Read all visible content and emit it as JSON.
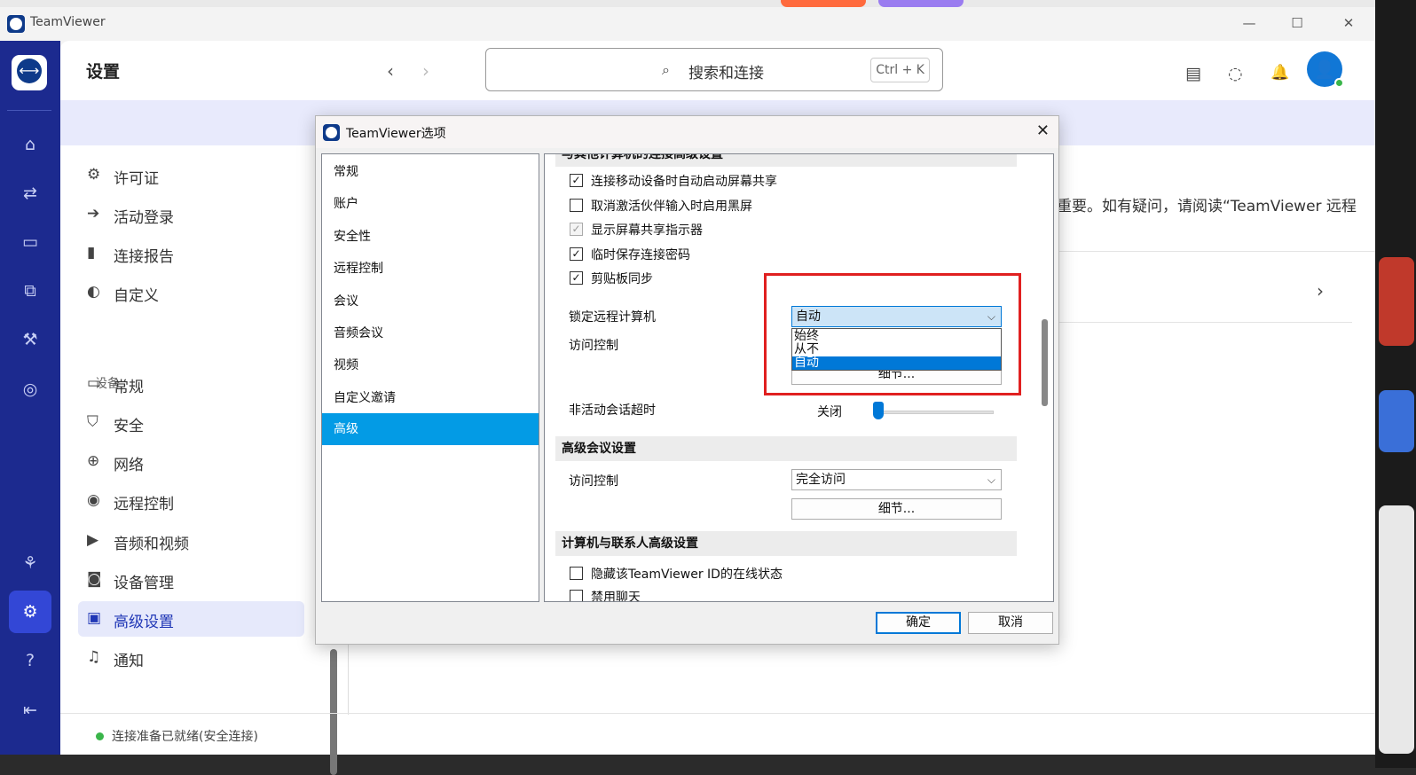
{
  "app": {
    "title": "TeamViewer",
    "window_controls": [
      "—",
      "☐",
      "✕"
    ]
  },
  "header": {
    "title": "设置",
    "back_icon": "‹",
    "forward_icon": "›",
    "search_icon": "⌕",
    "search_text": "搜索和连接",
    "search_shortcut": "Ctrl + K",
    "contact_icon": "▤",
    "chat_icon": "◌",
    "bell_icon": "🔔",
    "avatar_icon": "👤"
  },
  "nav_icons": [
    "⌂",
    "⇄",
    "▭",
    "⧉",
    "⚒",
    "◎",
    "⚘",
    "⚙",
    "?",
    "⇤"
  ],
  "settings_list": {
    "items_top": [
      {
        "icon": "⚙",
        "label": "许可证"
      },
      {
        "icon": "➔",
        "label": "活动登录"
      },
      {
        "icon": "▮",
        "label": "连接报告"
      },
      {
        "icon": "◐",
        "label": "自定义"
      }
    ],
    "group_label": "设备",
    "items_device": [
      {
        "icon": "▭",
        "label": "常规"
      },
      {
        "icon": "⛉",
        "label": "安全"
      },
      {
        "icon": "⊕",
        "label": "网络"
      },
      {
        "icon": "◉",
        "label": "远程控制"
      },
      {
        "icon": "▶",
        "label": "音频和视频"
      },
      {
        "icon": "◙",
        "label": "设备管理"
      },
      {
        "icon": "▣",
        "label": "高级设置"
      },
      {
        "icon": "♫",
        "label": "通知"
      }
    ]
  },
  "content": {
    "partial_text": "重要。如有疑问，请阅读“TeamViewer 远程",
    "chevron": "›"
  },
  "footer": {
    "status": "连接准备已就绪(安全连接)"
  },
  "dialog": {
    "title": "TeamViewer选项",
    "close": "✕",
    "categories": [
      "常规",
      "账户",
      "安全性",
      "远程控制",
      "会议",
      "音频会议",
      "视频",
      "自定义邀请",
      "高级"
    ],
    "selected_category": "高级",
    "section1_title": "与其他计算机的连接高级设置",
    "checkboxes1": [
      {
        "label": "连接移动设备时自动启动屏幕共享",
        "checked": "✓",
        "state": "checked"
      },
      {
        "label": "取消激活伙伴输入时启用黑屏",
        "checked": "",
        "state": "unchecked"
      },
      {
        "label": "显示屏幕共享指示器",
        "checked": "✓",
        "state": "disabled"
      },
      {
        "label": "临时保存连接密码",
        "checked": "✓",
        "state": "checked"
      },
      {
        "label": "剪贴板同步",
        "checked": "✓",
        "state": "checked"
      }
    ],
    "lock_label": "锁定远程计算机",
    "lock_value": "自动",
    "lock_options": [
      "始终",
      "从不",
      "自动"
    ],
    "lock_highlighted": "自动",
    "access_label": "访问控制",
    "details_label": "细节...",
    "timeout_label": "非活动会话超时",
    "timeout_value": "关闭",
    "timeout_level": 0,
    "section2_title": "高级会议设置",
    "meeting_access_label": "访问控制",
    "meeting_access_value": "完全访问",
    "meeting_details_label": "细节...",
    "section3_title": "计算机与联系人高级设置",
    "checkboxes3": [
      {
        "label": "隐藏该TeamViewer ID的在线状态",
        "checked": ""
      },
      {
        "label": "禁用聊天",
        "checked": ""
      }
    ],
    "ok": "确定",
    "cancel": "取消",
    "arrow": "⌵"
  }
}
